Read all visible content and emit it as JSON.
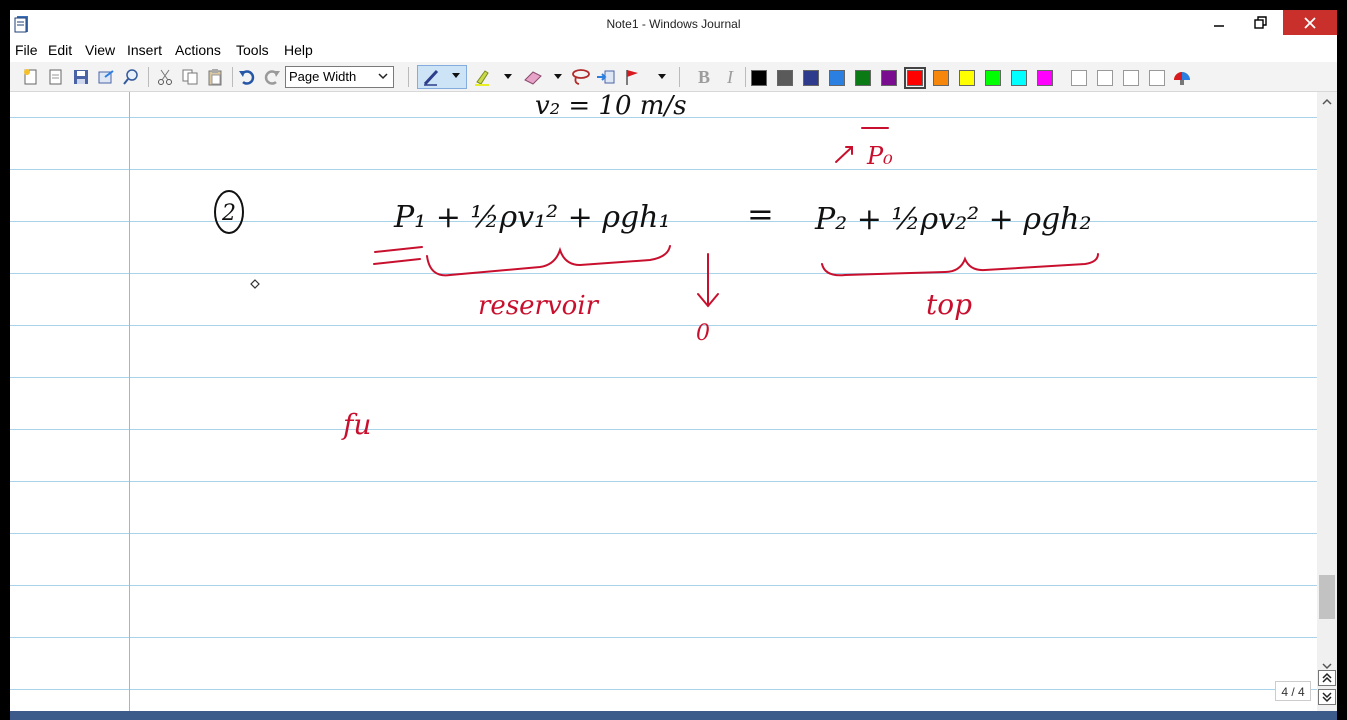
{
  "window": {
    "title": "Note1 - Windows Journal"
  },
  "menu": [
    "File",
    "Edit",
    "View",
    "Insert",
    "Actions",
    "Tools",
    "Help"
  ],
  "toolbar": {
    "zoom_value": "Page Width",
    "bold_label": "B",
    "italic_label": "I",
    "pen_colors": [
      "#000000",
      "#5a5a5a",
      "#2e3a8c",
      "#2b7fe0",
      "#0a7a14",
      "#7a0d8f",
      "#ff0000",
      "#f7860c",
      "#ffff00",
      "#00ff00",
      "#00ffff",
      "#ff00ff"
    ],
    "selected_color": "#ff0000"
  },
  "note": {
    "line1": "v₂ = 10 m/s",
    "step_marker": "2",
    "equation_left": "P₁ + ½ρv₁² + ρgh₁",
    "equals": "=",
    "equation_right": "P₂ + ½ρv₂² + ρgh₂",
    "p0_annotation": "P₀",
    "reservoir_label": "reservoir",
    "h1_value": "0",
    "top_label": "top",
    "partial_word": "fu"
  },
  "status": {
    "page_indicator": "4 / 4"
  },
  "ink_colors": {
    "black": "#111111",
    "red": "#c8102e"
  }
}
